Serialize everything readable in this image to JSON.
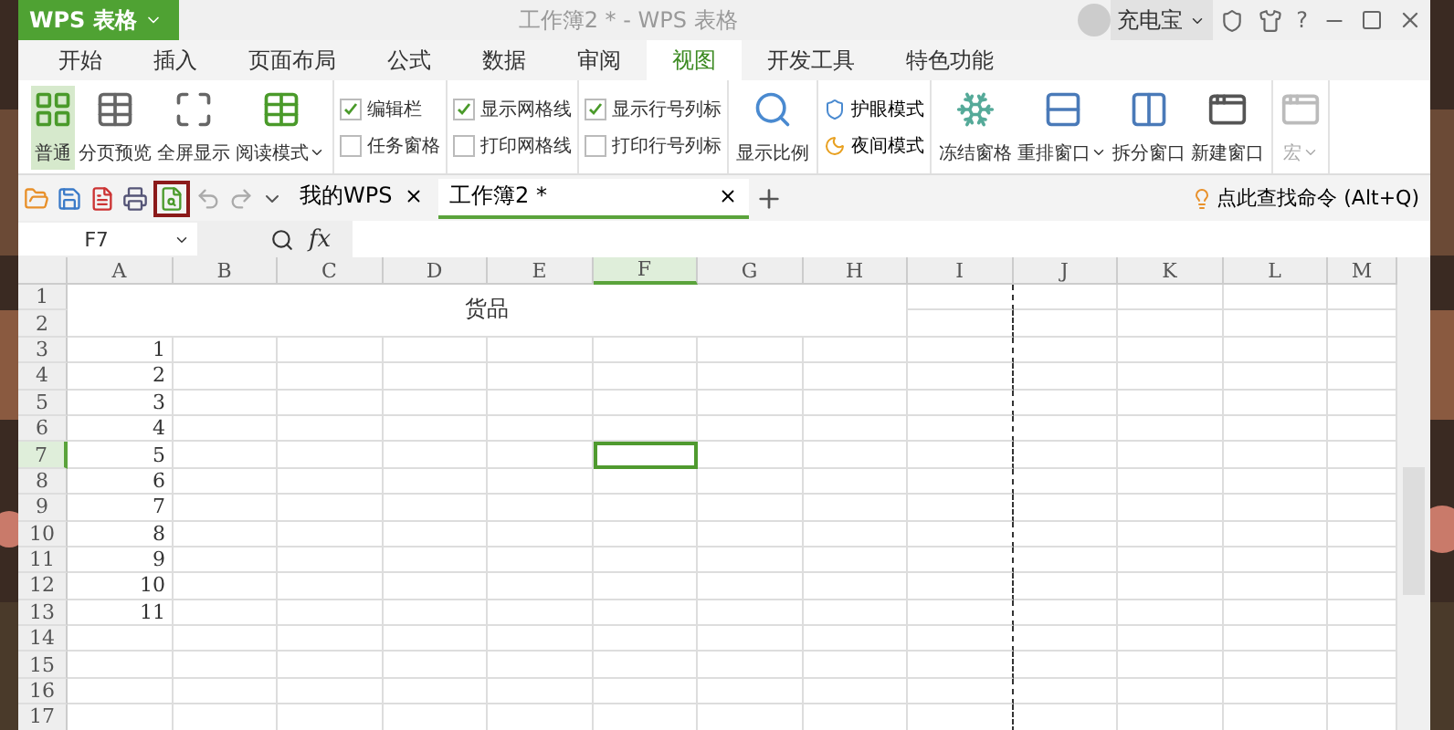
{
  "app_menu": {
    "label": "WPS 表格"
  },
  "window": {
    "title": "工作簿2 * - WPS 表格"
  },
  "user": {
    "name": "充电宝",
    "help": "?"
  },
  "ribbon_tabs": [
    {
      "label": "开始",
      "selected": false
    },
    {
      "label": "插入",
      "selected": false
    },
    {
      "label": "页面布局",
      "selected": false
    },
    {
      "label": "公式",
      "selected": false
    },
    {
      "label": "数据",
      "selected": false
    },
    {
      "label": "审阅",
      "selected": false
    },
    {
      "label": "视图",
      "selected": true
    },
    {
      "label": "开发工具",
      "selected": false
    },
    {
      "label": "特色功能",
      "selected": false
    }
  ],
  "ribbon": {
    "view_buttons": [
      {
        "label": "普通",
        "selected": true,
        "dropdown": false
      },
      {
        "label": "分页预览",
        "selected": false,
        "dropdown": false
      },
      {
        "label": "全屏显示",
        "selected": false,
        "dropdown": false
      },
      {
        "label": "阅读模式",
        "selected": false,
        "dropdown": true
      }
    ],
    "checkboxes": [
      {
        "label": "编辑栏",
        "checked": true
      },
      {
        "label": "任务窗格",
        "checked": false
      },
      {
        "label": "显示网格线",
        "checked": true
      },
      {
        "label": "打印网格线",
        "checked": false
      },
      {
        "label": "显示行号列标",
        "checked": true
      },
      {
        "label": "打印行号列标",
        "checked": false
      }
    ],
    "zoom": "显示比例",
    "modes": [
      {
        "label": "护眼模式",
        "kind": "eye"
      },
      {
        "label": "夜间模式",
        "kind": "moon"
      }
    ],
    "window_buttons": [
      {
        "label": "冻结窗格",
        "kind": "freeze",
        "dropdown": false
      },
      {
        "label": "重排窗口",
        "kind": "arrange",
        "dropdown": true
      },
      {
        "label": "拆分窗口",
        "kind": "split",
        "dropdown": false
      },
      {
        "label": "新建窗口",
        "kind": "new",
        "dropdown": false
      }
    ],
    "macro": {
      "label": "宏",
      "disabled": true
    }
  },
  "doc_tabs": [
    {
      "label": "我的WPS",
      "selected": false
    },
    {
      "label": "工作簿2 *",
      "selected": true
    }
  ],
  "command_search": "点此查找命令 (Alt+Q)",
  "formula_bar": {
    "cell": "F7",
    "fx": "fx"
  },
  "sheet": {
    "title": "货品",
    "columns": [
      {
        "label": "A",
        "selected": false
      },
      {
        "label": "B",
        "selected": false
      },
      {
        "label": "C",
        "selected": false
      },
      {
        "label": "D",
        "selected": false
      },
      {
        "label": "E",
        "selected": false
      },
      {
        "label": "F",
        "selected": true
      },
      {
        "label": "G",
        "selected": false
      },
      {
        "label": "H",
        "selected": false
      },
      {
        "label": "I",
        "selected": false
      },
      {
        "label": "J",
        "selected": false
      },
      {
        "label": "K",
        "selected": false
      },
      {
        "label": "L",
        "selected": false
      },
      {
        "label": "M",
        "selected": false
      }
    ],
    "rows": [
      {
        "label": "1",
        "selected": false
      },
      {
        "label": "2",
        "selected": false
      },
      {
        "label": "3",
        "selected": false,
        "value": "1"
      },
      {
        "label": "4",
        "selected": false,
        "value": "2"
      },
      {
        "label": "5",
        "selected": false,
        "value": "3"
      },
      {
        "label": "6",
        "selected": false,
        "value": "4"
      },
      {
        "label": "7",
        "selected": true,
        "value": "5"
      },
      {
        "label": "8",
        "selected": false,
        "value": "6"
      },
      {
        "label": "9",
        "selected": false,
        "value": "7"
      },
      {
        "label": "10",
        "selected": false,
        "value": "8"
      },
      {
        "label": "11",
        "selected": false,
        "value": "9"
      },
      {
        "label": "12",
        "selected": false,
        "value": "10"
      },
      {
        "label": "13",
        "selected": false,
        "value": "11"
      },
      {
        "label": "14",
        "selected": false
      },
      {
        "label": "15",
        "selected": false
      },
      {
        "label": "16",
        "selected": false
      },
      {
        "label": "17",
        "selected": false
      }
    ]
  }
}
